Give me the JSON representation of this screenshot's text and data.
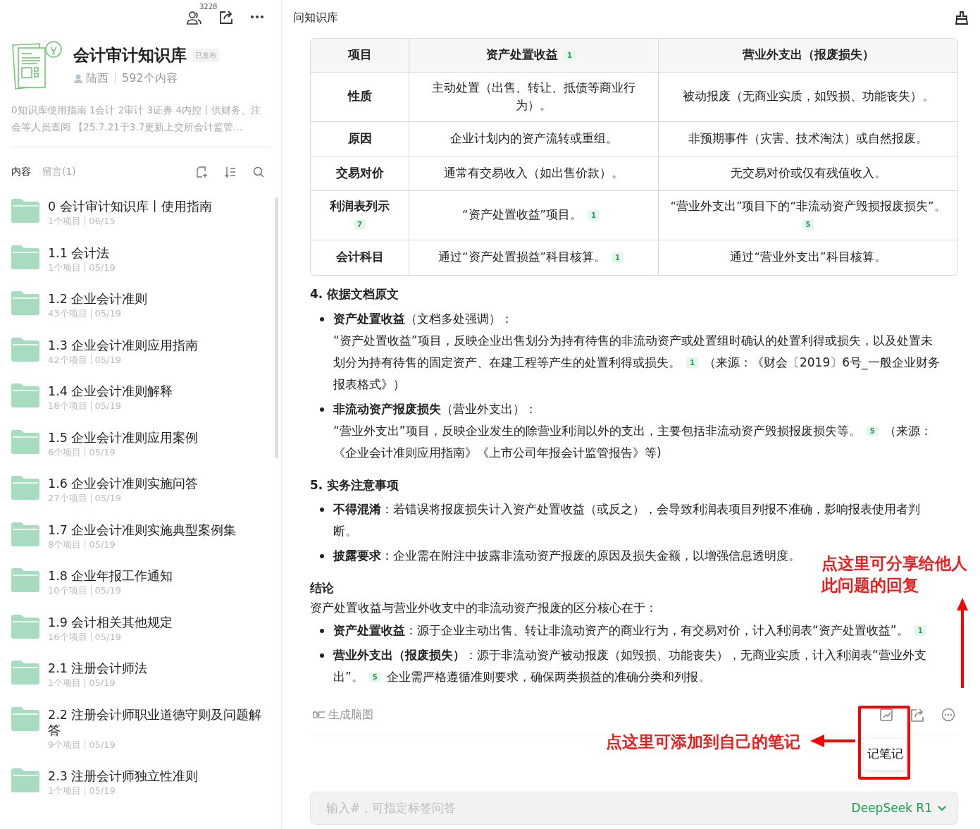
{
  "sidebar": {
    "members_count": "3228",
    "kb": {
      "title": "会计审计知识库",
      "status": "已发布",
      "author": "陆西",
      "count": "592个内容",
      "description": "0知识库使用指南 1会计 2审计 3证券 4内控丨供财务、注会等人员查阅 【25.7.21于3.7更新上交所会计监管..."
    },
    "tabs": [
      {
        "label": "内容",
        "selected": true
      },
      {
        "label": "留言(1)",
        "selected": false
      }
    ],
    "folders": [
      {
        "name": "0 会计审计知识库丨使用指南",
        "items": "1个项目",
        "date": "06/15"
      },
      {
        "name": "1.1 会计法",
        "items": "1个项目",
        "date": "05/19"
      },
      {
        "name": "1.2 企业会计准则",
        "items": "43个项目",
        "date": "05/19"
      },
      {
        "name": "1.3 企业会计准则应用指南",
        "items": "42个项目",
        "date": "05/19"
      },
      {
        "name": "1.4 企业会计准则解释",
        "items": "18个项目",
        "date": "05/19"
      },
      {
        "name": "1.5 企业会计准则应用案例",
        "items": "6个项目",
        "date": "05/19"
      },
      {
        "name": "1.6 企业会计准则实施问答",
        "items": "27个项目",
        "date": "05/19"
      },
      {
        "name": "1.7 企业会计准则实施典型案例集",
        "items": "8个项目",
        "date": "05/19"
      },
      {
        "name": "1.8 企业年报工作通知",
        "items": "10个项目",
        "date": "05/19"
      },
      {
        "name": "1.9 会计相关其他规定",
        "items": "16个项目",
        "date": "05/19"
      },
      {
        "name": "2.1 注册会计师法",
        "items": "1个项目",
        "date": "05/19"
      },
      {
        "name": "2.2 注册会计师职业道德守则及问题解答",
        "items": "9个项目",
        "date": "05/19"
      },
      {
        "name": "2.3 注册会计师独立性准则",
        "items": "1个项目",
        "date": "05/19"
      }
    ]
  },
  "main": {
    "title": "问知识库",
    "table": {
      "columns": [
        {
          "text": "项目"
        },
        {
          "text": "资产处置收益",
          "cite": "1"
        },
        {
          "text": "营业外支出（报废损失）"
        }
      ],
      "rows": [
        {
          "cells": [
            {
              "text": "性质"
            },
            {
              "text": "主动处置（出售、转让、抵债等商业行为）。"
            },
            {
              "text": "被动报废（无商业实质，如毁损、功能丧失）。"
            }
          ]
        },
        {
          "cells": [
            {
              "text": "原因"
            },
            {
              "text": "企业计划内的资产流转或重组。"
            },
            {
              "text": "非预期事件（灾害、技术淘汰）或自然报废。"
            }
          ]
        },
        {
          "cells": [
            {
              "text": "交易对价"
            },
            {
              "text": "通常有交易收入（如出售价款）。"
            },
            {
              "text": "无交易对价或仅有残值收入。"
            }
          ]
        },
        {
          "cells": [
            {
              "text": "利润表列示",
              "cite": "7"
            },
            {
              "text": "“资产处置收益”项目。",
              "cite": "1"
            },
            {
              "text": "“营业外支出”项目下的“非流动资产毁损报废损失”。",
              "cite": "5"
            }
          ]
        },
        {
          "cells": [
            {
              "text": "会计科目"
            },
            {
              "text": "通过“资产处置损益”科目核算。",
              "cite": "1"
            },
            {
              "text": "通过“营业外支出”科目核算。"
            }
          ]
        }
      ]
    },
    "sections": [
      {
        "heading": "4. 依据文档原文",
        "bullets": [
          {
            "lines": [
              [
                {
                  "kind": "text",
                  "text": "**资产处置收益**（文档多处强调）："
                }
              ],
              [
                {
                  "kind": "text",
                  "text": "“资产处置收益”项目，反映企业出售划分为持有待售的非流动资产或处置组时确认的处置利得或损失，以及处置未"
                }
              ],
              [
                {
                  "kind": "text",
                  "text": "划分为持有待售的固定资产、在建工程等产生的处置利得或损失。"
                },
                {
                  "kind": "cite",
                  "text": "1"
                },
                {
                  "kind": "text",
                  "text": "（来源：《财会〔2019〕6号_一般企业财务"
                }
              ],
              [
                {
                  "kind": "text",
                  "text": "报表格式》）"
                }
              ]
            ]
          },
          {
            "lines": [
              [
                {
                  "kind": "text",
                  "text": "**非流动资产报废损失**（营业外支出）："
                }
              ],
              [
                {
                  "kind": "text",
                  "text": "“营业外支出”项目，反映企业发生的除营业利润以外的支出，主要包括非流动资产毁损报废损失等。"
                },
                {
                  "kind": "cite",
                  "text": "5"
                },
                {
                  "kind": "text",
                  "text": "（来源："
                }
              ],
              [
                {
                  "kind": "text",
                  "text": "《企业会计准则应用指南》《上市公司年报会计监管报告》等)"
                }
              ]
            ]
          }
        ]
      },
      {
        "heading": "5. 实务注意事项",
        "bullets": [
          {
            "lines": [
              [
                {
                  "kind": "text",
                  "text": "**不得混淆**：若错误将报废损失计入资产处置收益（或反之），会导致利润表项目列报不准确，影响报表使用者判"
                }
              ],
              [
                {
                  "kind": "text",
                  "text": "断。"
                }
              ]
            ]
          },
          {
            "lines": [
              [
                {
                  "kind": "text",
                  "text": "**披露要求**：企业需在附注中披露非流动资产报废的原因及损失金额，以增强信息透明度。"
                }
              ]
            ]
          }
        ]
      },
      {
        "heading": "结论",
        "intro": "资产处置收益与营业外收支中的非流动资产报废的区分核心在于：",
        "bullets": [
          {
            "lines": [
              [
                {
                  "kind": "text",
                  "text": "**资产处置收益**：源于企业主动出售、转让非流动资产的商业行为，有交易对价，计入利润表“资产处置收益”。"
                },
                {
                  "kind": "cite",
                  "text": "1"
                }
              ]
            ]
          },
          {
            "lines": [
              [
                {
                  "kind": "text",
                  "text": "**营业外支出（报废损失）**：源于非流动资产被动报废（如毁损、功能丧失），无商业实质，计入利润表“营业外支"
                }
              ],
              [
                {
                  "kind": "text",
                  "text": "出”。"
                },
                {
                  "kind": "cite",
                  "text": "5"
                },
                {
                  "kind": "text",
                  "text": "企业需严格遵循准则要求，确保两类损益的准确分类和列报。"
                }
              ]
            ]
          }
        ]
      }
    ],
    "mindmap_button": "生成脑图",
    "tooltip": "记笔记",
    "input": {
      "placeholder": "输入#，可指定标签问答",
      "model": "DeepSeek R1"
    }
  },
  "annotations": [
    {
      "text": "点这里可分享给他人此问题的回复"
    },
    {
      "text": "点这里可添加到自己的笔记"
    }
  ]
}
